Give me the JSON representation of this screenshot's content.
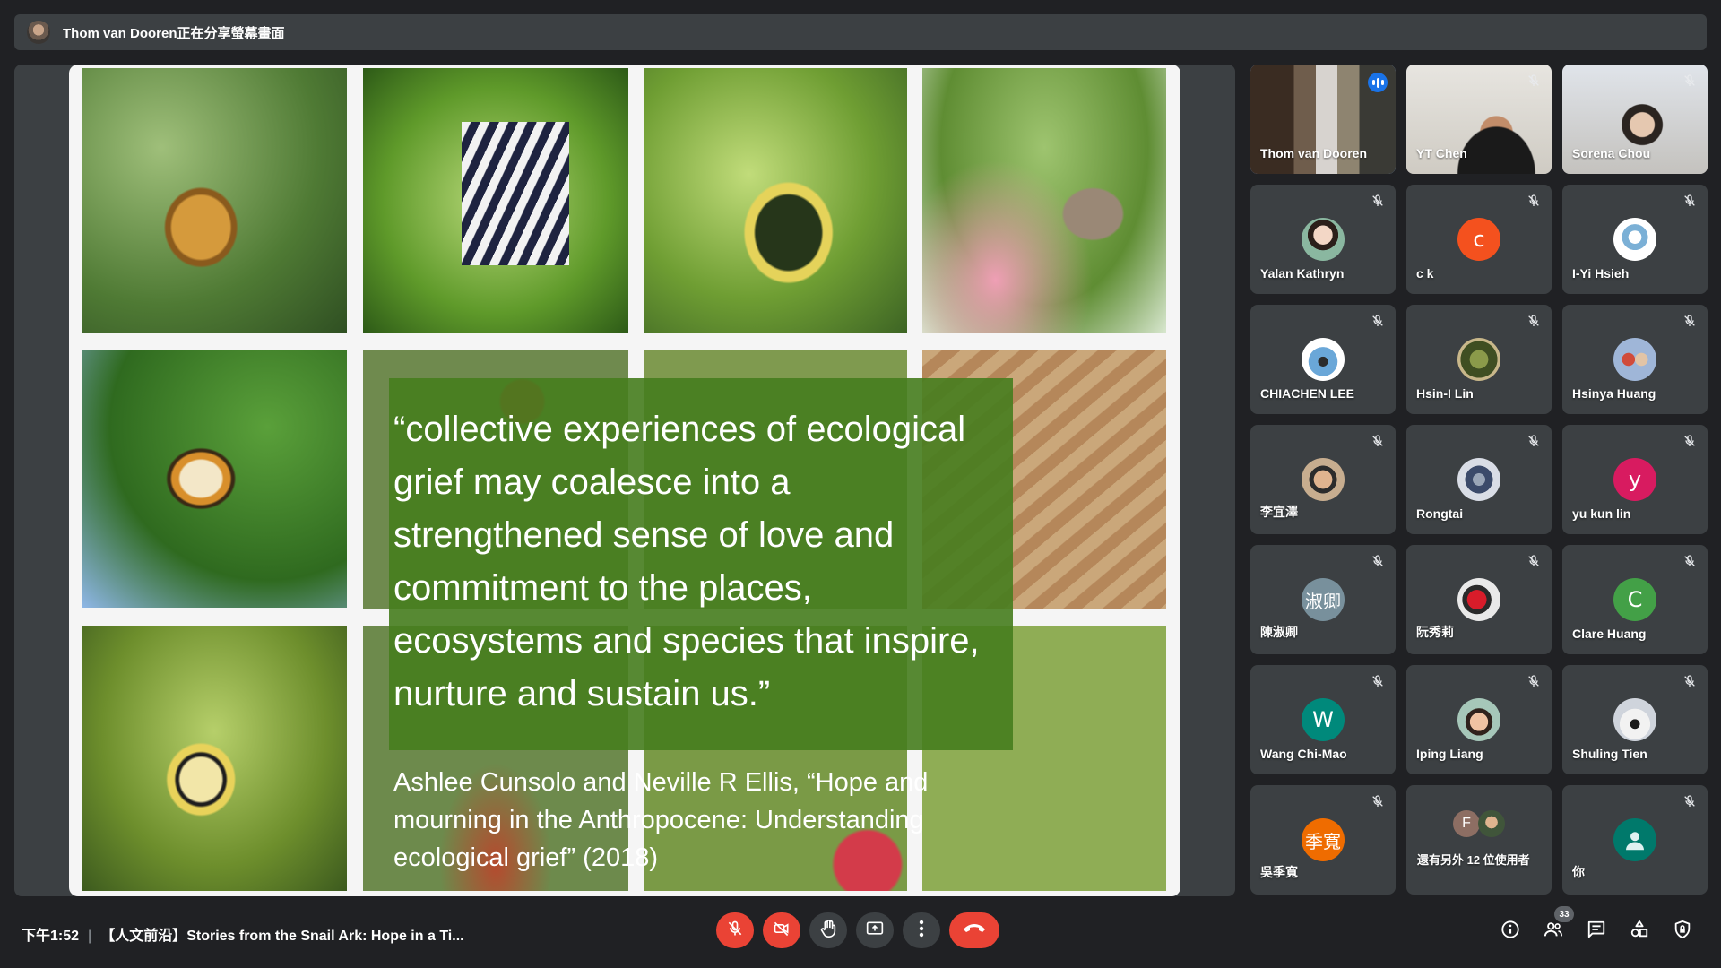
{
  "banner": {
    "text": "Thom van Dooren正在分享螢幕畫面"
  },
  "slide": {
    "quote": "“collective experiences of ecological grief may coalesce into a strengthened sense of love and commitment to the places, ecosystems and species that inspire, nurture and sustain us.”",
    "citation": "Ashlee Cunsolo and Neville R Ellis, “Hope and mourning in the Anthropocene: Understanding ecological grief” (2018)"
  },
  "participants": [
    {
      "name": "Thom van Dooren",
      "type": "video",
      "speaking": true
    },
    {
      "name": "YT Chen",
      "type": "video",
      "muted": true
    },
    {
      "name": "Sorena Chou",
      "type": "video",
      "muted": true
    },
    {
      "name": "Yalan Kathryn",
      "type": "photo",
      "muted": true
    },
    {
      "name": "c k",
      "type": "letter",
      "letter": "c",
      "color": "#f4511e",
      "muted": true
    },
    {
      "name": "I-Yi Hsieh",
      "type": "photo",
      "muted": true
    },
    {
      "name": "CHIACHEN LEE",
      "type": "photo",
      "muted": true
    },
    {
      "name": "Hsin-I Lin",
      "type": "photo",
      "muted": true
    },
    {
      "name": "Hsinya Huang",
      "type": "photo",
      "muted": true
    },
    {
      "name": "李宜澤",
      "type": "photo",
      "muted": true
    },
    {
      "name": "Rongtai",
      "type": "photo",
      "muted": true
    },
    {
      "name": "yu kun lin",
      "type": "letter",
      "letter": "y",
      "color": "#d81b60",
      "muted": true
    },
    {
      "name": "陳淑卿",
      "type": "letter",
      "letter": "淑卿",
      "color": "#78909c",
      "muted": true
    },
    {
      "name": "阮秀莉",
      "type": "photo",
      "muted": true
    },
    {
      "name": "Clare Huang",
      "type": "letter",
      "letter": "C",
      "color": "#43a047",
      "muted": true
    },
    {
      "name": "Wang Chi-Mao",
      "type": "letter",
      "letter": "W",
      "color": "#00897b",
      "muted": true
    },
    {
      "name": "Iping Liang",
      "type": "photo",
      "muted": true
    },
    {
      "name": "Shuling Tien",
      "type": "photo",
      "muted": true
    },
    {
      "name": "吳季寬",
      "type": "letter",
      "letter": "季寬",
      "color": "#ef6c00",
      "muted": true
    },
    {
      "name": "還有另外 12 位使用者",
      "type": "others"
    },
    {
      "name": "你",
      "type": "self",
      "muted": true
    }
  ],
  "others_avatar_letter": "F",
  "bottom": {
    "time": "下午1:52",
    "meeting_title": "【人文前沿】Stories from the Snail Ark: Hope in a Ti...",
    "participant_count": "33"
  },
  "colors": {
    "background": "#202124",
    "tile": "#3c4043",
    "danger": "#ea4335",
    "active_speaker": "#8ab4f8"
  }
}
